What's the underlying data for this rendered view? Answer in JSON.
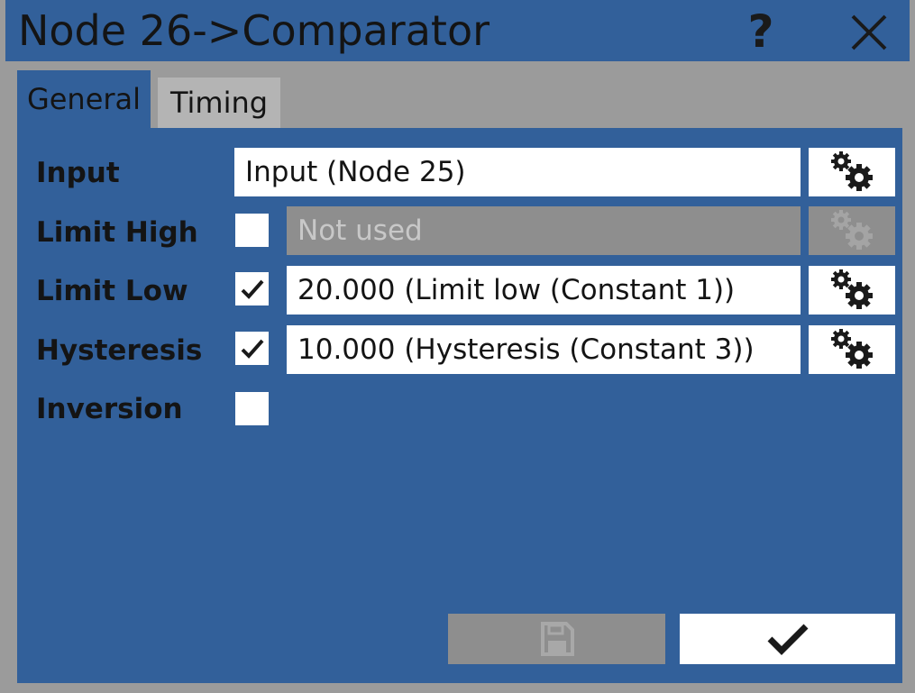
{
  "window": {
    "title": "Node 26->Comparator",
    "help_icon": "help-icon",
    "close_icon": "close-icon"
  },
  "tabs": [
    {
      "label": "General",
      "active": true
    },
    {
      "label": "Timing",
      "active": false
    }
  ],
  "form": {
    "input": {
      "label": "Input",
      "value": "Input (Node 25)",
      "icon": "gears-icon"
    },
    "limit_high": {
      "label": "Limit High",
      "checked": false,
      "value": "Not used",
      "enabled": false,
      "icon": "gears-icon"
    },
    "limit_low": {
      "label": "Limit Low",
      "checked": true,
      "value": "20.000 (Limit low (Constant 1))",
      "enabled": true,
      "icon": "gears-icon"
    },
    "hysteresis": {
      "label": "Hysteresis",
      "checked": true,
      "value": "10.000 (Hysteresis (Constant 3))",
      "enabled": true,
      "icon": "gears-icon"
    },
    "inversion": {
      "label": "Inversion",
      "checked": false
    }
  },
  "footer": {
    "save_icon": "save-icon",
    "save_enabled": false,
    "ok_icon": "checkmark-icon"
  },
  "colors": {
    "panel": "#32609a",
    "frame": "#9b9b9b",
    "inactive_tab": "#b4b4b4",
    "disabled": "#8e8e8e",
    "text": "#141414"
  }
}
